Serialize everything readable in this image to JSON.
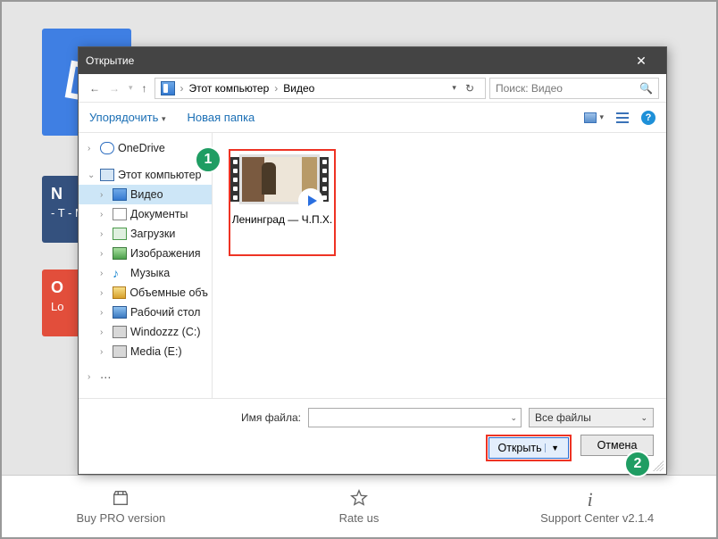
{
  "background": {
    "card_navy_title": "N",
    "card_navy_lines": "- T\n- М",
    "card_red_title": "O",
    "card_red_line": "Lo"
  },
  "bottom": {
    "buy": "Buy PRO version",
    "rate": "Rate us",
    "support": "Support Center  v2.1.4"
  },
  "dialog": {
    "title": "Открытие",
    "breadcrumb": {
      "root": "Этот компьютер",
      "node": "Видео"
    },
    "search_placeholder": "Поиск: Видео",
    "organize": "Упорядочить",
    "new_folder": "Новая папка",
    "tree": {
      "onedrive": "OneDrive",
      "this_pc": "Этот компьютер",
      "video": "Видео",
      "documents": "Документы",
      "downloads": "Загрузки",
      "images": "Изображения",
      "music": "Музыка",
      "volume": "Объемные объ",
      "desktop": "Рабочий стол",
      "drive_c": "Windozzz (C:)",
      "drive_e": "Media (E:)"
    },
    "file": {
      "name": "Ленинград — Ч.П.Х."
    },
    "filename_label": "Имя файла:",
    "filetype": "Все файлы",
    "open": "Открыть",
    "cancel": "Отмена"
  },
  "callout": {
    "one": "1",
    "two": "2"
  }
}
